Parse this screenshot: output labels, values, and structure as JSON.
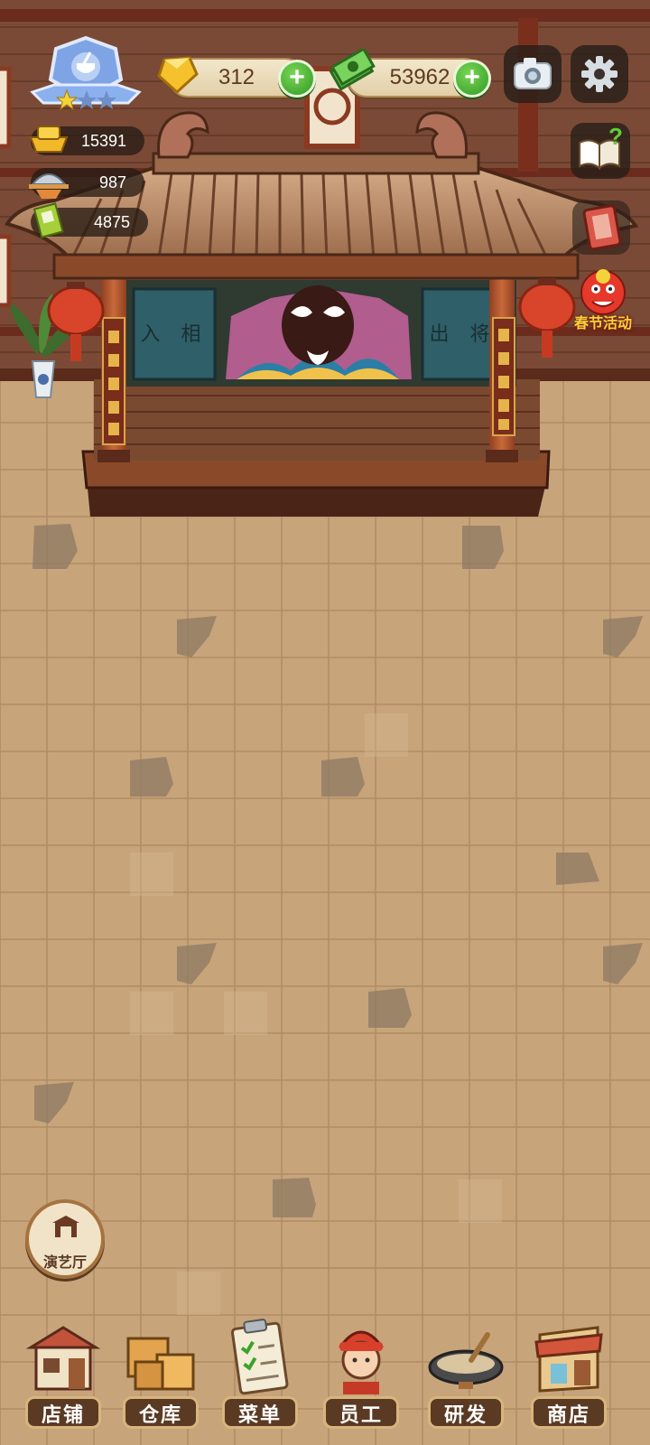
{
  "currencies": {
    "gems": "312",
    "cash": "53962"
  },
  "resources": {
    "gold": "15391",
    "dishes": "987",
    "books": "4875"
  },
  "theater_signs": {
    "left": "入 相",
    "right": "出 将"
  },
  "event_button": {
    "label": "春节活动"
  },
  "side_button": {
    "label": "演艺厅"
  },
  "nav": [
    {
      "label": "店铺",
      "icon": "shop-building-icon"
    },
    {
      "label": "仓库",
      "icon": "warehouse-boxes-icon"
    },
    {
      "label": "菜单",
      "icon": "menu-clipboard-icon"
    },
    {
      "label": "员工",
      "icon": "staff-chef-icon"
    },
    {
      "label": "研发",
      "icon": "research-wok-icon"
    },
    {
      "label": "商店",
      "icon": "store-stall-icon"
    }
  ],
  "colors": {
    "floor": "#c7a47a",
    "wall": "#6e3e2c",
    "accent_green": "#2f9a26",
    "event_text": "#f4d23a"
  }
}
